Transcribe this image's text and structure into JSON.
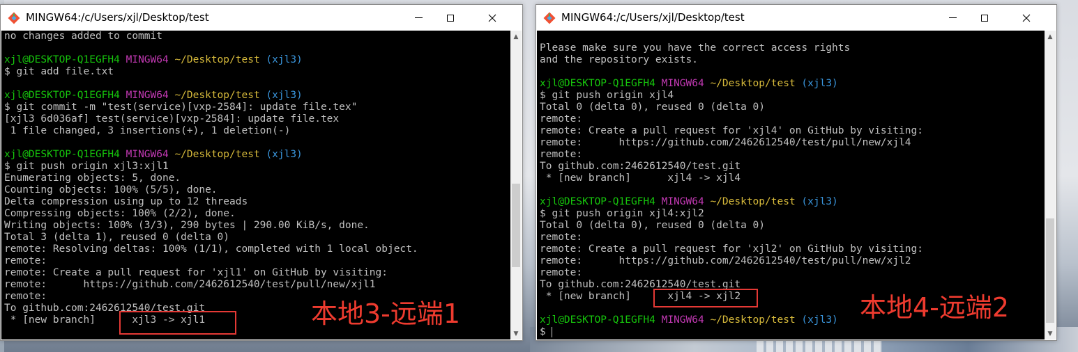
{
  "colors": {
    "prompt_user": "#16c60c",
    "prompt_host": "#c239b3",
    "prompt_path": "#d7ba3b",
    "prompt_branch": "#3a96dd",
    "text": "#c0c0c0",
    "annotation": "#ee3b2f"
  },
  "icons": {
    "app": "git-diamond-icon",
    "minimize": "minimize-icon",
    "maximize": "maximize-icon",
    "close": "close-icon"
  },
  "left_window": {
    "title": "MINGW64:/c/Users/xjl/Desktop/test",
    "lines": [
      {
        "text": "no changes added to commit"
      },
      {
        "text": ""
      },
      {
        "prompt": {
          "user": "xjl@DESKTOP-Q1EGFH4",
          "host": "MINGW64",
          "path": "~/Desktop/test",
          "branch": "(xjl3)"
        }
      },
      {
        "text": "$ git add file.txt"
      },
      {
        "text": ""
      },
      {
        "prompt": {
          "user": "xjl@DESKTOP-Q1EGFH4",
          "host": "MINGW64",
          "path": "~/Desktop/test",
          "branch": "(xjl3)"
        }
      },
      {
        "text": "$ git commit -m \"test(service)[vxp-2584]: update file.tex\""
      },
      {
        "text": "[xjl3 6d036af] test(service)[vxp-2584]: update file.tex"
      },
      {
        "text": " 1 file changed, 3 insertions(+), 1 deletion(-)"
      },
      {
        "text": ""
      },
      {
        "prompt": {
          "user": "xjl@DESKTOP-Q1EGFH4",
          "host": "MINGW64",
          "path": "~/Desktop/test",
          "branch": "(xjl3)"
        }
      },
      {
        "text": "$ git push origin xjl3:xjl1"
      },
      {
        "text": "Enumerating objects: 5, done."
      },
      {
        "text": "Counting objects: 100% (5/5), done."
      },
      {
        "text": "Delta compression using up to 12 threads"
      },
      {
        "text": "Compressing objects: 100% (2/2), done."
      },
      {
        "text": "Writing objects: 100% (3/3), 290 bytes | 290.00 KiB/s, done."
      },
      {
        "text": "Total 3 (delta 1), reused 0 (delta 0)"
      },
      {
        "text": "remote: Resolving deltas: 100% (1/1), completed with 1 local object."
      },
      {
        "text": "remote:"
      },
      {
        "text": "remote: Create a pull request for 'xjl1' on GitHub by visiting:"
      },
      {
        "text": "remote:      https://github.com/2462612540/test/pull/new/xjl1"
      },
      {
        "text": "remote:"
      },
      {
        "text": "To github.com:2462612540/test.git"
      },
      {
        "text": " * [new branch]      xjl3 -> xjl1"
      }
    ],
    "annotation": "本地3-远端1"
  },
  "right_window": {
    "title": "MINGW64:/c/Users/xjl/Desktop/test",
    "lines": [
      {
        "text": ""
      },
      {
        "text": "Please make sure you have the correct access rights"
      },
      {
        "text": "and the repository exists."
      },
      {
        "text": ""
      },
      {
        "prompt": {
          "user": "xjl@DESKTOP-Q1EGFH4",
          "host": "MINGW64",
          "path": "~/Desktop/test",
          "branch": "(xjl3)"
        }
      },
      {
        "text": "$ git push origin xjl4"
      },
      {
        "text": "Total 0 (delta 0), reused 0 (delta 0)"
      },
      {
        "text": "remote:"
      },
      {
        "text": "remote: Create a pull request for 'xjl4' on GitHub by visiting:"
      },
      {
        "text": "remote:      https://github.com/2462612540/test/pull/new/xjl4"
      },
      {
        "text": "remote:"
      },
      {
        "text": "To github.com:2462612540/test.git"
      },
      {
        "text": " * [new branch]      xjl4 -> xjl4"
      },
      {
        "text": ""
      },
      {
        "prompt": {
          "user": "xjl@DESKTOP-Q1EGFH4",
          "host": "MINGW64",
          "path": "~/Desktop/test",
          "branch": "(xjl3)"
        }
      },
      {
        "text": "$ git push origin xjl4:xjl2"
      },
      {
        "text": "Total 0 (delta 0), reused 0 (delta 0)"
      },
      {
        "text": "remote:"
      },
      {
        "text": "remote: Create a pull request for 'xjl2' on GitHub by visiting:"
      },
      {
        "text": "remote:      https://github.com/2462612540/test/pull/new/xjl2"
      },
      {
        "text": "remote:"
      },
      {
        "text": "To github.com:2462612540/test.git"
      },
      {
        "text": " * [new branch]      xjl4 -> xjl2"
      },
      {
        "text": ""
      },
      {
        "prompt": {
          "user": "xjl@DESKTOP-Q1EGFH4",
          "host": "MINGW64",
          "path": "~/Desktop/test",
          "branch": "(xjl3)"
        }
      },
      {
        "text": "$ ",
        "cursor": true
      }
    ],
    "annotation": "本地4-远端2"
  }
}
